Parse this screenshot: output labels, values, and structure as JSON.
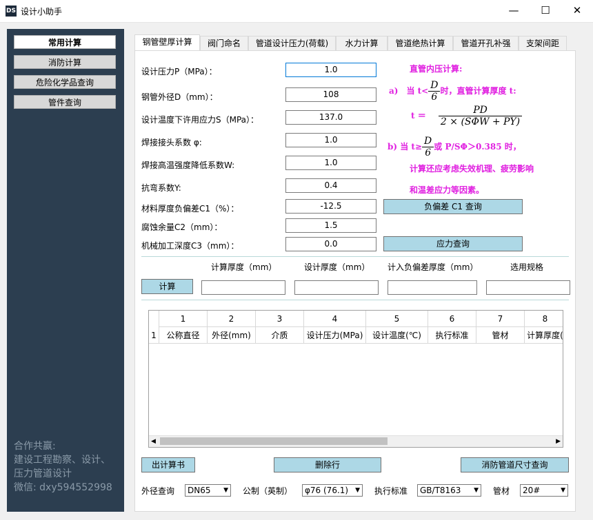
{
  "window": {
    "title": "设计小助手",
    "logo": "DS",
    "minimize": "—",
    "maximize": "☐",
    "close": "✕"
  },
  "sidebar": {
    "items": [
      {
        "label": "常用计算"
      },
      {
        "label": "消防计算"
      },
      {
        "label": "危险化学品查询"
      },
      {
        "label": "管件查询"
      }
    ],
    "footer": "合作共赢:\n建设工程勘察、设计、\n压力管道设计\n微信: dxy594552998"
  },
  "tabs": [
    "钢管壁厚计算",
    "阀门命名",
    "管道设计压力(荷载)",
    "水力计算",
    "管道绝热计算",
    "管道开孔补强",
    "支架间距"
  ],
  "form": {
    "fields": [
      {
        "label": "设计压力P（MPa）：",
        "value": "1.0"
      },
      {
        "label": "钢管外径D（mm）：",
        "value": "108"
      },
      {
        "label": "设计温度下许用应力S（MPa）：",
        "value": "137.0"
      },
      {
        "label": "焊接接头系数 φ:",
        "value": "1.0"
      },
      {
        "label": "焊接高温强度降低系数W:",
        "value": "1.0"
      },
      {
        "label": "抗弯系数Y:",
        "value": "0.4"
      },
      {
        "label": "材料厚度负偏差C1（%）：",
        "value": "-12.5"
      },
      {
        "label": "腐蚀余量C2（mm）：",
        "value": "1.5"
      },
      {
        "label": "机械加工深度C3（mm）：",
        "value": "0.0"
      }
    ],
    "c1_query_button": "负偏差 C1 查询",
    "stress_query_button": "应力查询"
  },
  "formula": {
    "title": "直管内压计算:",
    "line_a": "a)　当 t<",
    "line_a_tail": "时，直管计算厚度 t:",
    "frac_d": "D",
    "frac_6": "6",
    "t_eq": "t ＝",
    "pd": "PD",
    "denom": "2 × (SΦW + PY)",
    "line_b": "b) 当 t≥",
    "line_b_tail": "或 P/SΦ＞0.385 时，",
    "note1": "计算还应考虑失效机理、疲劳影响",
    "note2": "和温差应力等因素。"
  },
  "results": {
    "headers": [
      "计算厚度（mm）",
      "设计厚度（mm）",
      "计入负偏差厚度（mm）",
      "选用规格"
    ],
    "calc_button": "计算"
  },
  "table": {
    "col_numbers": [
      "1",
      "2",
      "3",
      "4",
      "5",
      "6",
      "7",
      "8"
    ],
    "row_number": "1",
    "columns": [
      "公称直径",
      "外径(mm)",
      "介质",
      "设计压力(MPa)",
      "设计温度(℃)",
      "执行标准",
      "管材",
      "计算厚度("
    ]
  },
  "bottom_buttons": {
    "report": "出计算书",
    "delete_row": "删除行",
    "fire_query": "消防管道尺寸查询"
  },
  "bottom_bar": {
    "od_label": "外径查询",
    "od_value": "DN65",
    "unit_label": "公制（英制）",
    "unit_value": "φ76 (76.1)",
    "std_label": "执行标准",
    "std_value": "GB/T8163",
    "mat_label": "管材",
    "mat_value": "20#"
  }
}
